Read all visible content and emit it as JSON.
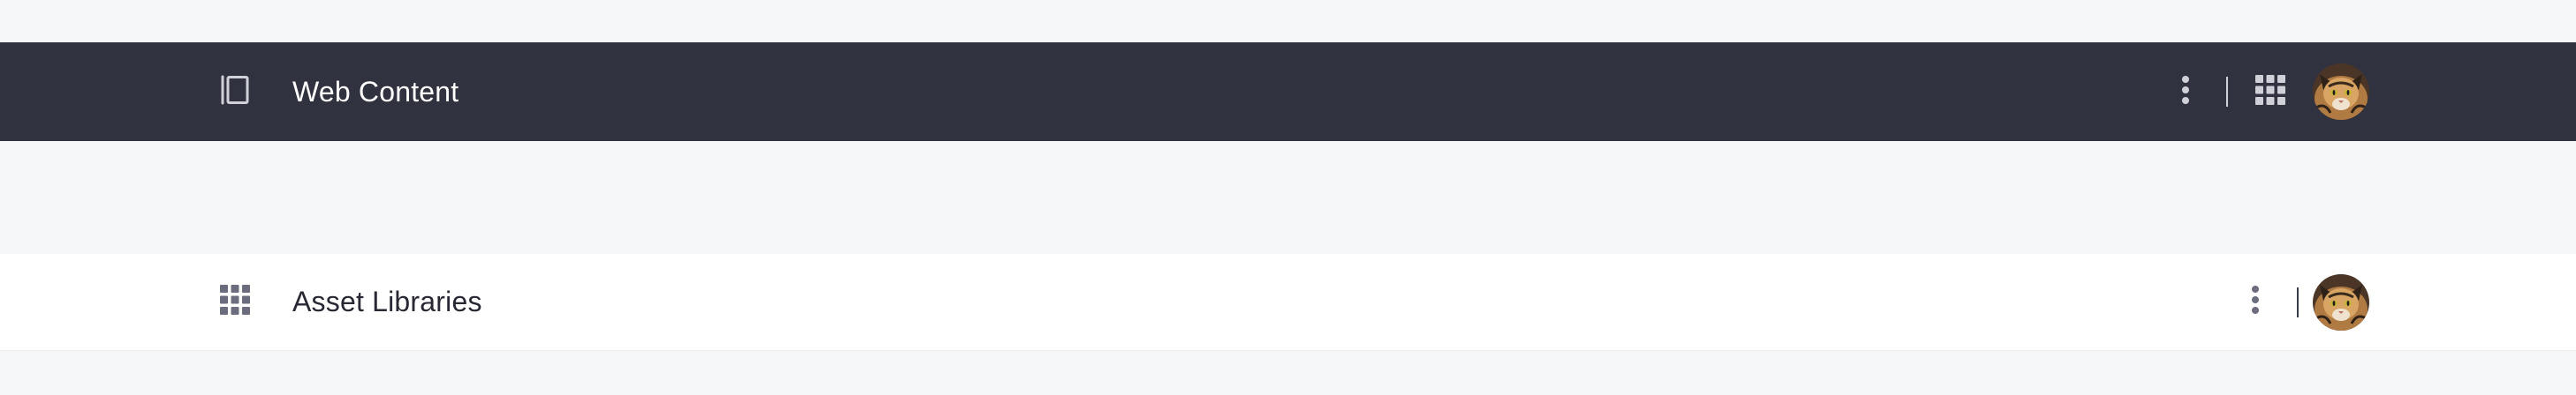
{
  "primary_bar": {
    "title": "Web Content",
    "background": "#31323f",
    "left_icon": "sidebar-panel-icon",
    "actions": [
      "kebab-menu-icon",
      "apps-grid-icon",
      "user-avatar"
    ]
  },
  "secondary_bar": {
    "title": "Asset Libraries",
    "background": "#ffffff",
    "left_icon": "apps-grid-icon",
    "actions": [
      "kebab-menu-icon",
      "user-avatar"
    ]
  },
  "colors": {
    "page_background": "#f6f7f9",
    "icon_light": "#cfd0d8",
    "icon_dark": "#6b6c7e"
  }
}
